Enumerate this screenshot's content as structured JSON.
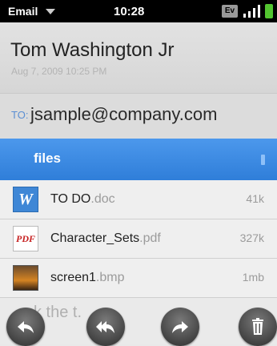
{
  "status_bar": {
    "app_name": "Email",
    "time": "10:28",
    "network": "Ev"
  },
  "message": {
    "sender": "Tom Washington Jr",
    "date": "Aug 7, 2009 10:25 PM",
    "to_label": "TO:",
    "to_address": "jsample@company.com"
  },
  "attachments": {
    "header": "files",
    "items": [
      {
        "name": "TO DO",
        "ext": ".doc",
        "size": "41k",
        "icon": "word-doc-icon"
      },
      {
        "name": "Character_Sets",
        "ext": ".pdf",
        "size": "327k",
        "icon": "pdf-icon"
      },
      {
        "name": "screen1",
        "ext": ".bmp",
        "size": "1mb",
        "icon": "image-icon"
      }
    ]
  },
  "body": {
    "visible_text": "ck the    t."
  },
  "toolbar": {
    "buttons": [
      "reply-icon",
      "reply-all-icon",
      "forward-icon",
      "delete-icon"
    ]
  },
  "colors": {
    "accent": "#3a8be6",
    "battery": "#53c430"
  }
}
